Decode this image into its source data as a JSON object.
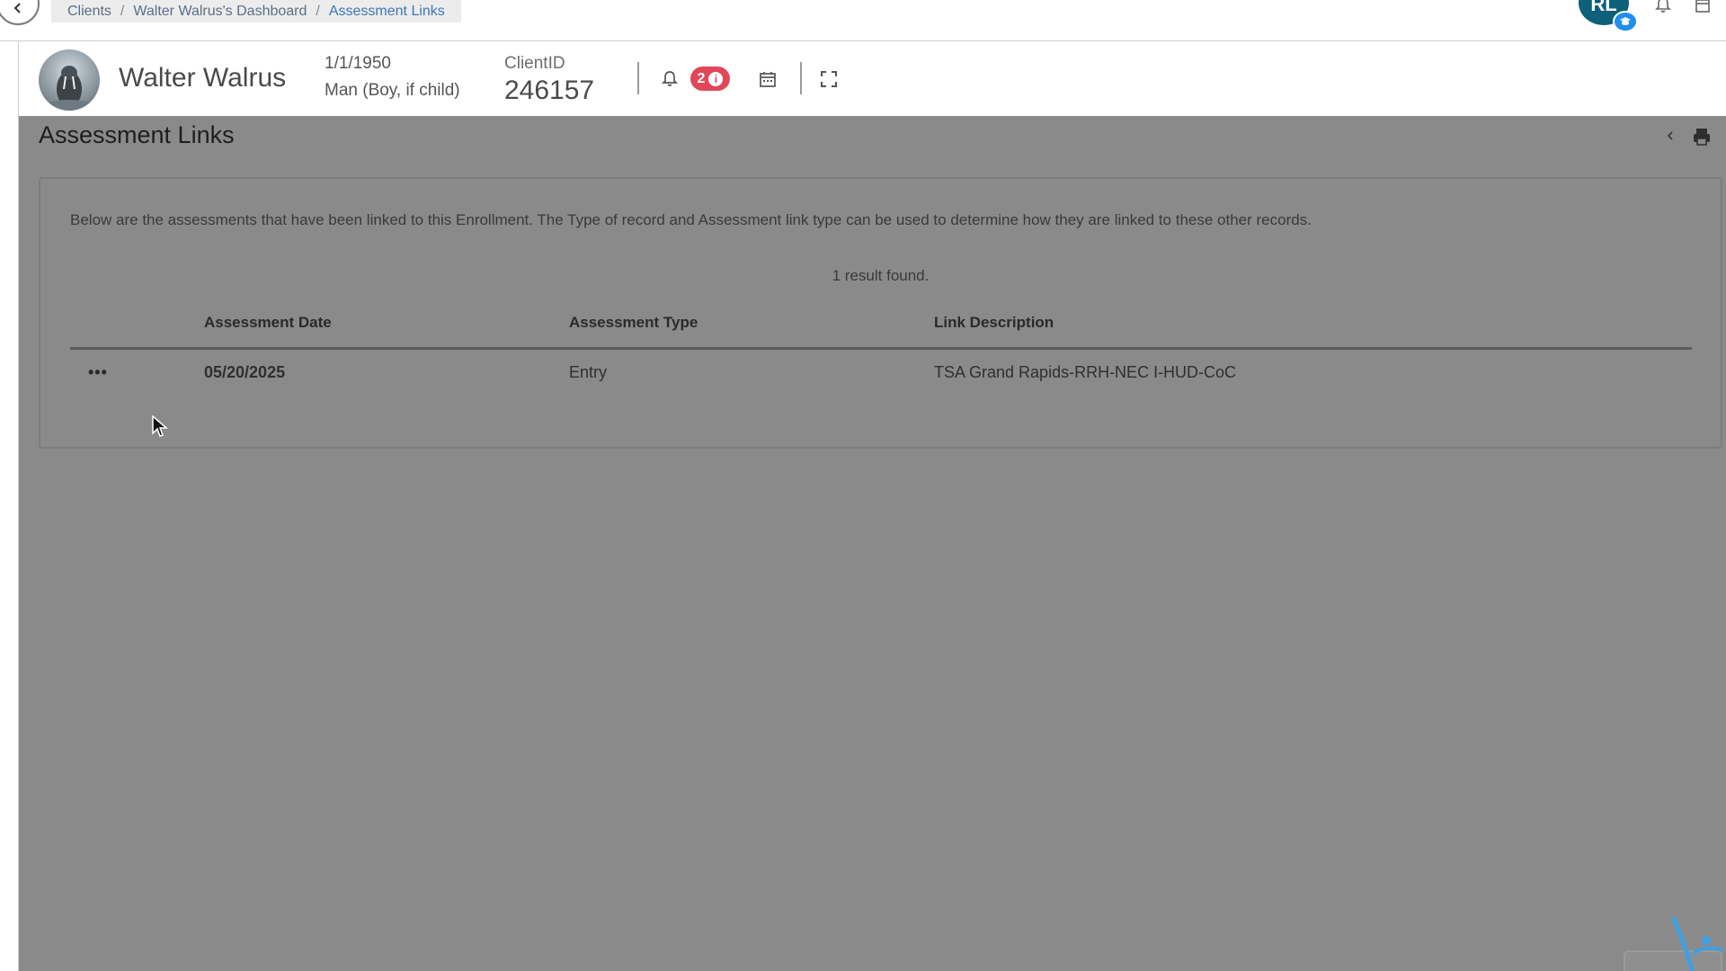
{
  "breadcrumb": {
    "items": [
      "Clients",
      "Walter Walrus's Dashboard",
      "Assessment Links"
    ],
    "separator": "/"
  },
  "user": {
    "initials": "RL"
  },
  "client": {
    "name": "Walter Walrus",
    "dob": "1/1/1950",
    "gender": "Man (Boy, if child)",
    "id_label": "ClientID",
    "id_value": "246157",
    "alert_count": "2"
  },
  "page": {
    "title": "Assessment Links",
    "description": "Below are the assessments that have been linked to this Enrollment.  The Type of record and Assessment link type can be used to determine how they are linked to these other records.",
    "result_count": "1 result found."
  },
  "table": {
    "columns": [
      "Assessment Date",
      "Assessment Type",
      "Link Description"
    ],
    "rows": [
      {
        "actions": "•••",
        "date": "05/20/2025",
        "type": "Entry",
        "link": "TSA Grand Rapids-RRH-NEC I-HUD-CoC"
      }
    ]
  },
  "colors": {
    "accent": "#3c78b5",
    "alert": "#e0485a",
    "avatar": "#0e5f7a",
    "overlay": "#8a8a8a"
  }
}
